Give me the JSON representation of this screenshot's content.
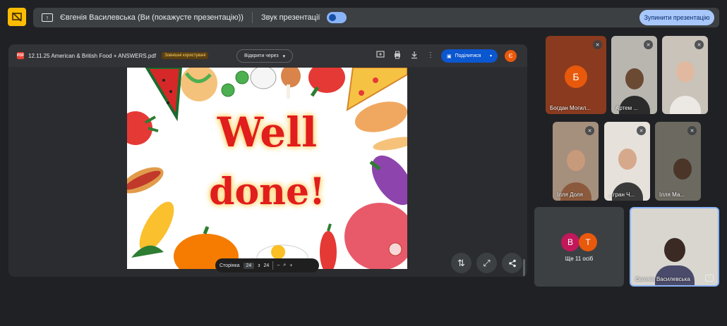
{
  "topbar": {
    "presenter_text": "Євгенія Василевська (Ви (покажусте презентацію))",
    "sound_label": "Звук презентації",
    "stop_button": "Зупинити презентацію"
  },
  "viewer": {
    "file_name": "12.11.25 American & British Food + ANSWERS.pdf",
    "badge": "Зовнішні користувачі",
    "open_with": "Відкрити через",
    "share": "Поділитися",
    "account_initial": "Є",
    "page_label": "Сторінка",
    "current_page": "24",
    "of": "з",
    "total_pages": "24",
    "zoom_out": "−",
    "zoom_in": "+"
  },
  "slide": {
    "line1": "Well",
    "line2": "done!"
  },
  "participants": [
    {
      "name": "Богдан Могил...",
      "initial": "Б"
    },
    {
      "name": "Артем ..."
    },
    {
      "name": "Ілля Доля"
    },
    {
      "name": "...гран Ч..."
    },
    {
      "name": "Ілля Ма..."
    },
    {
      "name": "Євгенія Василевська"
    }
  ],
  "more": {
    "chips": [
      "В",
      "Т"
    ],
    "text": "Ще 11 осіб"
  },
  "colors": {
    "accent": "#0b57d0",
    "stop_button_bg": "#a8c7fa",
    "slide_text": "#e11d1d",
    "avatar_orange": "#e8590c",
    "chip_purple": "#c2185b"
  }
}
